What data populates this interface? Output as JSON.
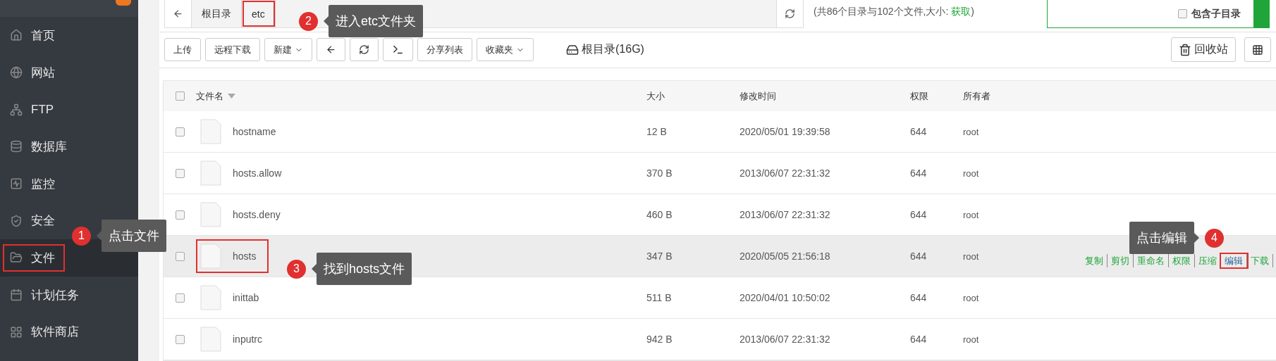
{
  "sidebar": {
    "items": [
      {
        "label": "首页",
        "selected": false,
        "highlighted": false
      },
      {
        "label": "网站",
        "selected": false,
        "highlighted": false
      },
      {
        "label": "FTP",
        "selected": false,
        "highlighted": false
      },
      {
        "label": "数据库",
        "selected": false,
        "highlighted": false
      },
      {
        "label": "监控",
        "selected": false,
        "highlighted": false
      },
      {
        "label": "安全",
        "selected": false,
        "highlighted": false
      },
      {
        "label": "文件",
        "selected": true,
        "highlighted": true
      },
      {
        "label": "计划任务",
        "selected": false,
        "highlighted": false
      },
      {
        "label": "软件商店",
        "selected": false,
        "highlighted": false
      }
    ]
  },
  "breadcrumb": {
    "crumbs": [
      {
        "label": "根目录",
        "highlighted": false
      },
      {
        "label": "etc",
        "highlighted": true
      }
    ],
    "summary": {
      "prefix": "(共86个目录与102个文件,大小: ",
      "link": "获取",
      "suffix": ")"
    }
  },
  "search": {
    "include_subdirs_label": "包含子目录",
    "include_subdirs_checked": false
  },
  "toolbar": {
    "buttons": [
      {
        "kind": "text",
        "label": "上传"
      },
      {
        "kind": "text",
        "label": "远程下载"
      },
      {
        "kind": "dropdown",
        "label": "新建"
      },
      {
        "kind": "back"
      },
      {
        "kind": "refresh"
      },
      {
        "kind": "terminal"
      },
      {
        "kind": "text",
        "label": "分享列表"
      },
      {
        "kind": "dropdown",
        "label": "收藏夹"
      }
    ],
    "disk_label": "根目录(16G)",
    "recycle_label": "回收站"
  },
  "table": {
    "all_checked": false,
    "columns": [
      {
        "label": "文件名",
        "sorted": true
      },
      {
        "label": "大小",
        "sorted": false
      },
      {
        "label": "修改时间",
        "sorted": false
      },
      {
        "label": "权限",
        "sorted": false
      },
      {
        "label": "所有者",
        "sorted": false
      }
    ],
    "rows": [
      {
        "name": "hostname",
        "size": "12 B",
        "modified": "2020/05/01 19:39:58",
        "permission": "644",
        "owner": "root",
        "checked": false,
        "hovered": false,
        "highlighted": false
      },
      {
        "name": "hosts.allow",
        "size": "370 B",
        "modified": "2013/06/07 22:31:32",
        "permission": "644",
        "owner": "root",
        "checked": false,
        "hovered": false,
        "highlighted": false
      },
      {
        "name": "hosts.deny",
        "size": "460 B",
        "modified": "2013/06/07 22:31:32",
        "permission": "644",
        "owner": "root",
        "checked": false,
        "hovered": false,
        "highlighted": false
      },
      {
        "name": "hosts",
        "size": "347 B",
        "modified": "2020/05/05 21:56:18",
        "permission": "644",
        "owner": "root",
        "checked": false,
        "hovered": true,
        "highlighted": true,
        "actions": [
          {
            "label": "复制",
            "highlighted": false
          },
          {
            "label": "剪切",
            "highlighted": false
          },
          {
            "label": "重命名",
            "highlighted": false
          },
          {
            "label": "权限",
            "highlighted": false
          },
          {
            "label": "压缩",
            "highlighted": false
          },
          {
            "label": "编辑",
            "highlighted": true
          },
          {
            "label": "下载",
            "highlighted": false
          }
        ]
      },
      {
        "name": "inittab",
        "size": "511 B",
        "modified": "2020/04/01 10:50:02",
        "permission": "644",
        "owner": "root",
        "checked": false,
        "hovered": false,
        "highlighted": false
      },
      {
        "name": "inputrc",
        "size": "942 B",
        "modified": "2013/06/07 22:31:32",
        "permission": "644",
        "owner": "root",
        "checked": false,
        "hovered": false,
        "highlighted": false
      }
    ]
  },
  "annotations": [
    {
      "number": "1",
      "text": "点击文件"
    },
    {
      "number": "2",
      "text": "进入etc文件夹"
    },
    {
      "number": "3",
      "text": "找到hosts文件"
    },
    {
      "number": "4",
      "text": "点击编辑"
    }
  ]
}
